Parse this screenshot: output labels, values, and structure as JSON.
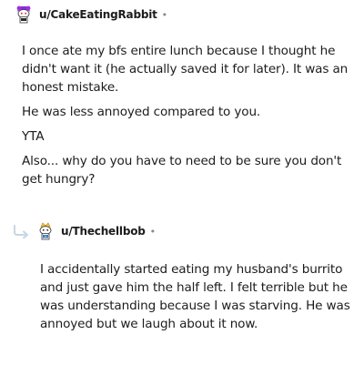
{
  "comment1": {
    "username": "u/CakeEatingRabbit",
    "separator": "•",
    "avatar_icon": "snoo-avatar-purple-hair-icon",
    "paragraphs": [
      "I once ate my bfs entire lunch because I thought he didn't want it (he actually saved it for later). It was an honest mistake.",
      "He was less annoyed compared to you.",
      "YTA",
      "Also... why do you have to need to be sure you don't get hungry?"
    ]
  },
  "comment2": {
    "username": "u/Thechellbob",
    "separator": "•",
    "avatar_icon": "snoo-avatar-crown-icon",
    "reply_icon": "reply-arrow-icon",
    "paragraphs": [
      "I accidentally started eating my husband's burrito and just gave him the half left. I felt terrible but he was understanding because I was starving. He was annoyed but we laugh about it now."
    ]
  }
}
